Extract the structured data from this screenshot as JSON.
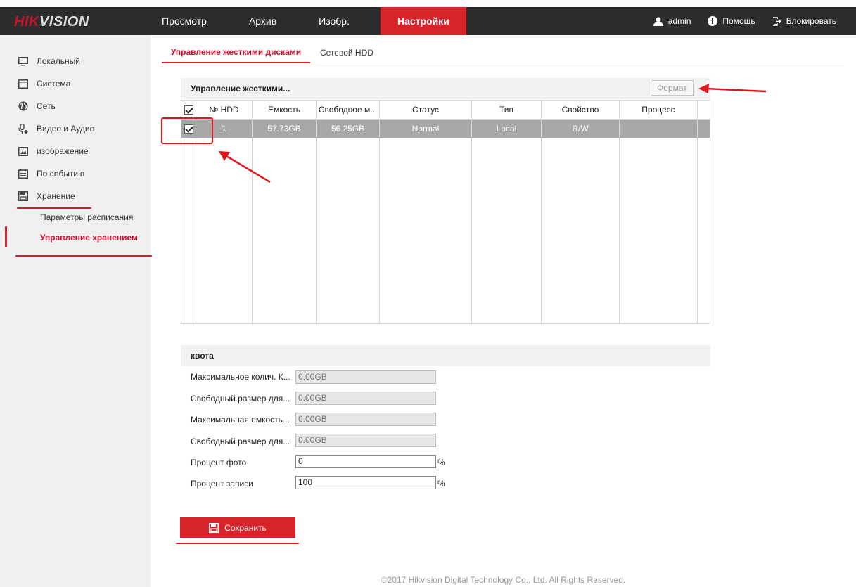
{
  "brand": {
    "logo_red": "HIK",
    "logo_rest": "VISION",
    "accent": "#d8232a"
  },
  "nav": {
    "items": [
      "Просмотр",
      "Архив",
      "Изобр.",
      "Настройки"
    ],
    "active": "Настройки",
    "user": "admin",
    "help": "Помощь",
    "logout": "Блокировать"
  },
  "sidebar": {
    "items": [
      {
        "label": "Локальный",
        "icon": "monitor-icon"
      },
      {
        "label": "Система",
        "icon": "window-icon"
      },
      {
        "label": "Сеть",
        "icon": "globe-icon"
      },
      {
        "label": "Видео и Аудио",
        "icon": "mic-icon"
      },
      {
        "label": "изображение",
        "icon": "image-icon"
      },
      {
        "label": "По событию",
        "icon": "calendar-icon"
      },
      {
        "label": "Хранение",
        "icon": "floppy-icon"
      }
    ],
    "sub_items": [
      "Параметры расписания",
      "Управление хранением"
    ],
    "active_sub": "Управление хранением"
  },
  "tabs": [
    "Управление жесткими дисками",
    "Сетевой HDD"
  ],
  "hdd_panel": {
    "title": "Управление жесткими...",
    "format_label": "Формат",
    "columns": [
      "№ HDD",
      "Емкость",
      "Свободное м...",
      "Статус",
      "Тип",
      "Свойство",
      "Процесс"
    ],
    "rows": [
      {
        "checked": true,
        "no": "1",
        "capacity": "57.73GB",
        "free": "56.25GB",
        "status": "Normal",
        "type": "Local",
        "property": "R/W",
        "progress": ""
      }
    ]
  },
  "quota": {
    "title": "квота",
    "fields": [
      {
        "label": "Максимальное колич. К...",
        "value": "0.00GB"
      },
      {
        "label": "Свободный размер для...",
        "value": "0.00GB"
      },
      {
        "label": "Максимальная емкость...",
        "value": "0.00GB"
      },
      {
        "label": "Свободный размер для...",
        "value": "0.00GB"
      },
      {
        "label": "Процент фото",
        "value": "0",
        "unit": "%"
      },
      {
        "label": "Процент записи",
        "value": "100",
        "unit": "%"
      }
    ]
  },
  "save_label": "Сохранить",
  "footer": "©2017 Hikvision Digital Technology Co., Ltd. All Rights Reserved."
}
